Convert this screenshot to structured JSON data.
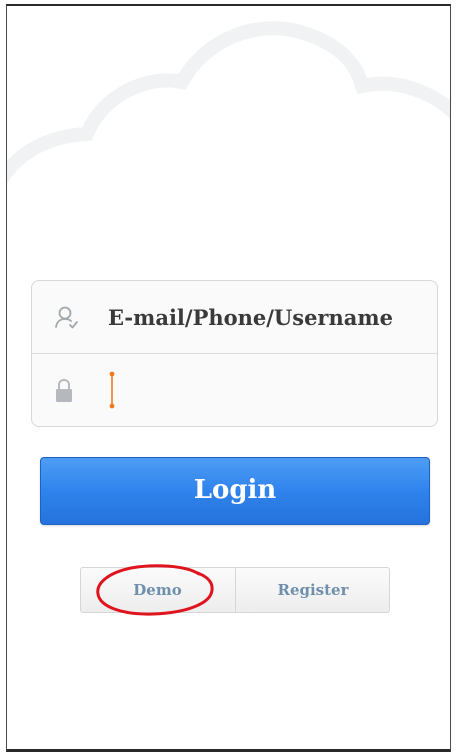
{
  "login_form": {
    "username_placeholder": "E-mail/Phone/Username",
    "password_value": ""
  },
  "login_button": {
    "label": "Login"
  },
  "mode_switch": {
    "demo_label": "Demo",
    "register_label": "Register"
  },
  "icons": {
    "username": "user-icon",
    "password": "lock-icon"
  },
  "colors": {
    "accent": "#2f83ec",
    "highlight_annotation": "#e0141e",
    "cursor": "#f07a1e"
  }
}
